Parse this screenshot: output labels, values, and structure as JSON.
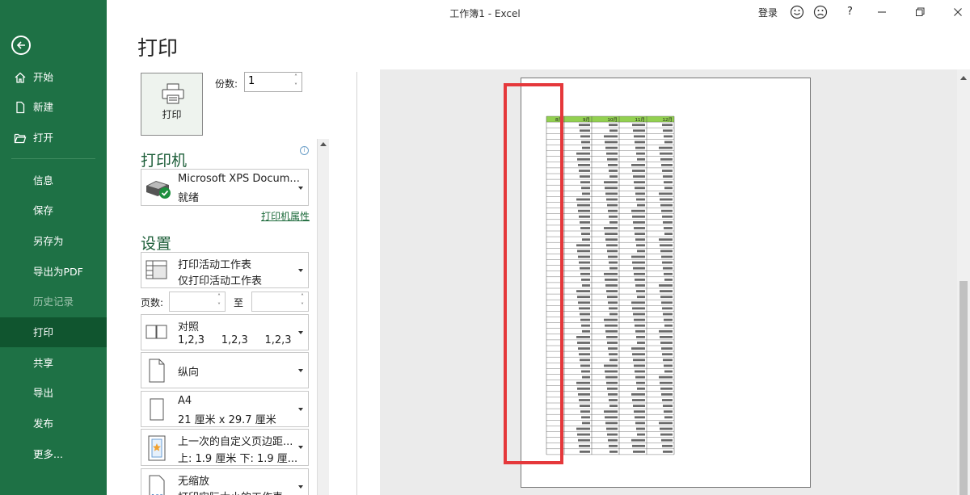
{
  "window": {
    "title": "工作簿1  -  Excel",
    "login": "登录",
    "help": "?"
  },
  "sidebar": {
    "items": [
      {
        "label": "开始",
        "icon": "home-icon"
      },
      {
        "label": "新建",
        "icon": "new-document-icon"
      },
      {
        "label": "打开",
        "icon": "folder-open-icon"
      },
      {
        "label": "信息"
      },
      {
        "label": "保存"
      },
      {
        "label": "另存为"
      },
      {
        "label": "导出为PDF"
      },
      {
        "label": "历史记录",
        "disabled": true
      },
      {
        "label": "打印",
        "active": true
      },
      {
        "label": "共享"
      },
      {
        "label": "导出"
      },
      {
        "label": "发布"
      },
      {
        "label": "更多..."
      }
    ]
  },
  "print": {
    "heading": "打印",
    "button_label": "打印",
    "copies_label": "份数:",
    "copies_value": "1",
    "printer_section": "打印机",
    "printer": {
      "name": "Microsoft XPS Docum...",
      "status": "就绪"
    },
    "printer_properties": "打印机属性",
    "settings_section": "设置",
    "settings": [
      {
        "line1": "打印活动工作表",
        "line2": "仅打印活动工作表",
        "icon": "sheet-icon"
      },
      {
        "line1": "对照",
        "line2": "1,2,3     1,2,3     1,2,3",
        "icon": "collate-icon"
      },
      {
        "line1": "纵向",
        "line2": "",
        "icon": "portrait-icon"
      },
      {
        "line1": "A4",
        "line2": "21 厘米 x 29.7 厘米",
        "icon": "paper-size-icon"
      },
      {
        "line1": "上一次的自定义页边距...",
        "line2": "上: 1.9 厘米 下: 1.9 厘...",
        "icon": "margins-icon"
      },
      {
        "line1": "无缩放",
        "line2": "打印实际大小的工作表",
        "icon": "scaling-icon"
      }
    ],
    "pages_label": "页数:",
    "to_label": "至"
  },
  "preview": {
    "headers": [
      "8月",
      "9月",
      "10月",
      "11月",
      "12月"
    ],
    "highlight_color": "#e5383b",
    "header_color": "#92d050"
  }
}
